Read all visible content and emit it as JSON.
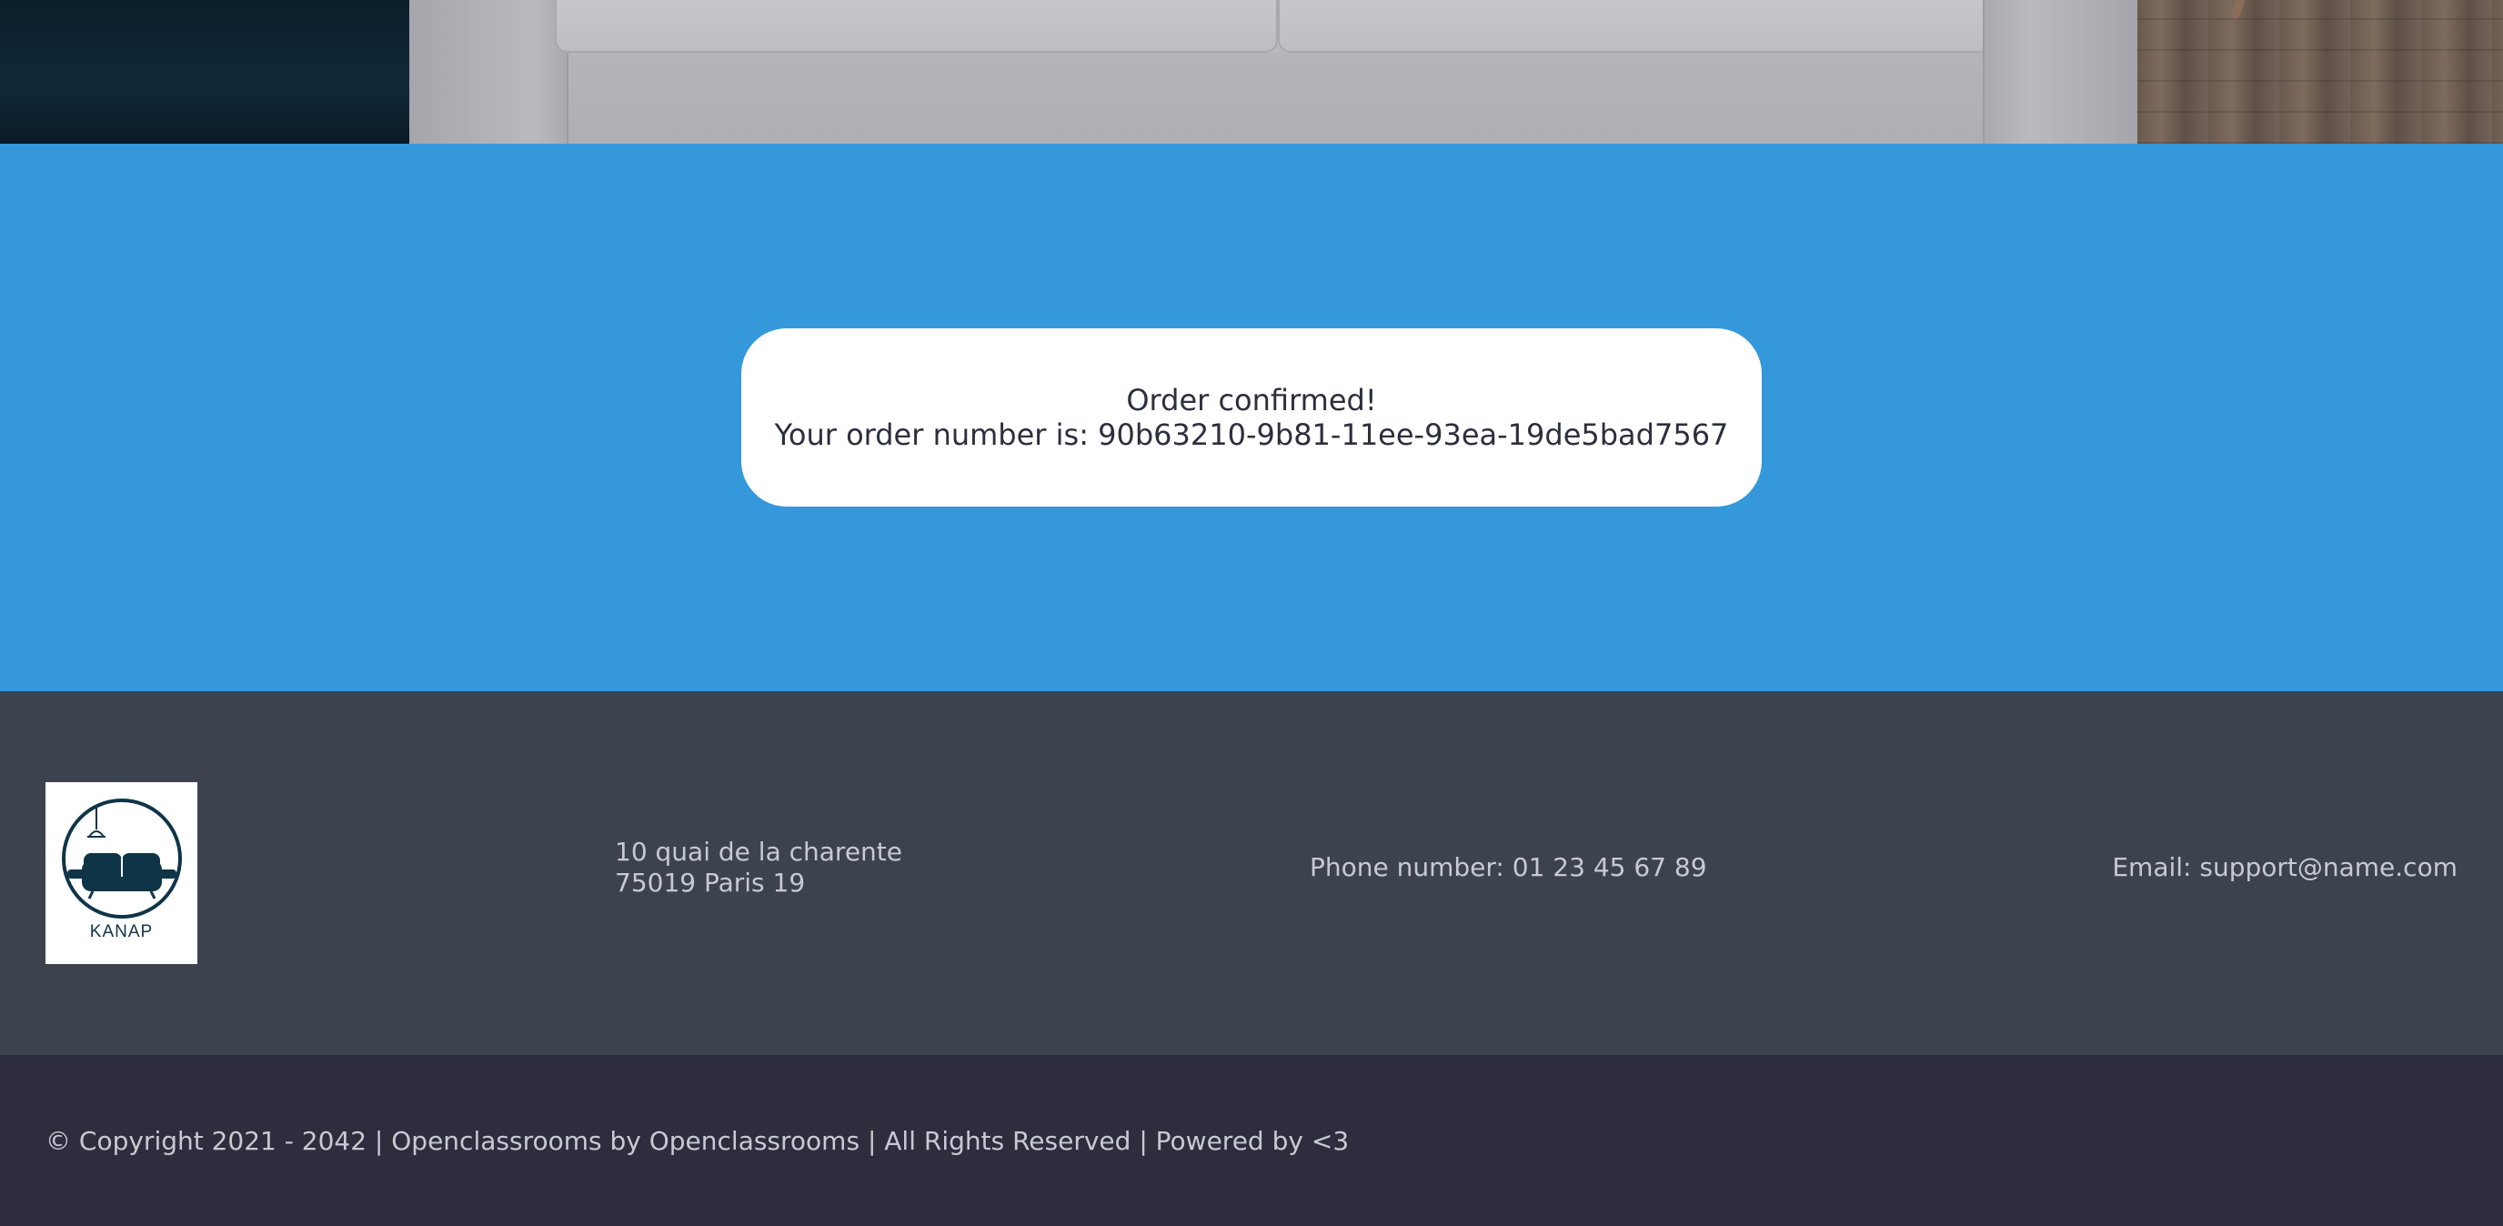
{
  "colors": {
    "confirm_band": "#3498db",
    "card": "#ffffff",
    "footer": "#3d424f",
    "bottom_bar": "#2d2d3d",
    "footer_text": "#c7cad3",
    "logo_accent": "#0f3447"
  },
  "hero": {
    "image": "sofa-banner-image"
  },
  "confirmation": {
    "title": "Order confirmed!",
    "order_line": "Your order number is: 90b63210-9b81-11ee-93ea-19de5bad7567"
  },
  "footer": {
    "logo_text": "KANAP",
    "address_line1": "10 quai de la charente",
    "address_line2": "75019 Paris 19",
    "phone": "Phone number: 01 23 45 67 89",
    "email": "Email: support@name.com"
  },
  "bottom_bar": {
    "copyright": "© Copyright 2021 - 2042 | Openclassrooms by Openclassrooms | All Rights Reserved | Powered by <3"
  }
}
